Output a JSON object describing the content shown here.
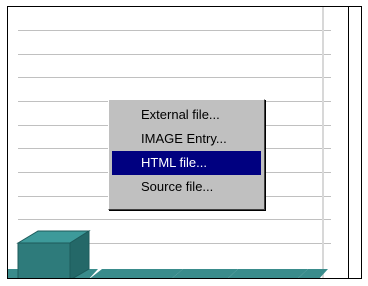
{
  "context_menu": {
    "items": [
      {
        "label": "External file..."
      },
      {
        "label": "IMAGE Entry..."
      },
      {
        "label": "HTML file..."
      },
      {
        "label": "Source file..."
      }
    ],
    "selected_index": 2,
    "selected_bg": "#000080",
    "selected_fg": "#ffffff",
    "menu_bg": "#c0c0c0"
  },
  "chart": {
    "bar_color": "#2e7b7b",
    "bar_top_color": "#3d9a9a",
    "floor_color": "#3a8c8c"
  }
}
